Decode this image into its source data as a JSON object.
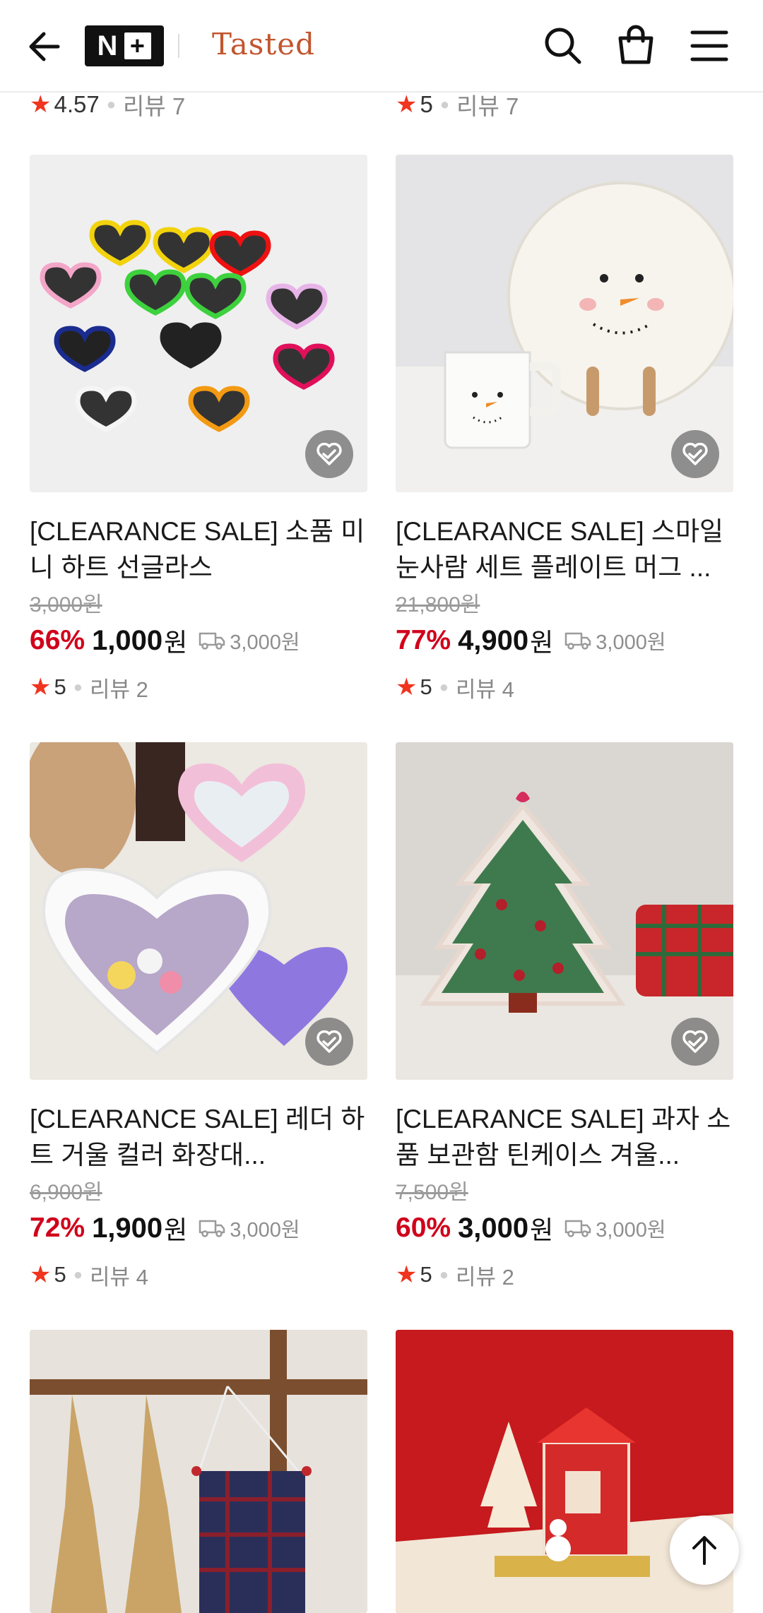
{
  "header": {
    "logo_text": "N",
    "logo_plus": "+",
    "brand": "Tasted"
  },
  "partial_top": [
    {
      "score": "4.57",
      "reviews": "리뷰 7"
    },
    {
      "score": "5",
      "reviews": "리뷰 7"
    }
  ],
  "products": [
    {
      "title": "[CLEARANCE SALE] 소품 미니 하트 선글라스",
      "original_price": "3,000원",
      "discount": "66%",
      "price": "1,000",
      "currency": "원",
      "shipping": "3,000원",
      "score": "5",
      "reviews": "리뷰 2"
    },
    {
      "title": "[CLEARANCE SALE] 스마일 눈사람 세트 플레이트 머그 ...",
      "original_price": "21,800원",
      "discount": "77%",
      "price": "4,900",
      "currency": "원",
      "shipping": "3,000원",
      "score": "5",
      "reviews": "리뷰 4"
    },
    {
      "title": "[CLEARANCE SALE] 레더 하트 거울 컬러 화장대...",
      "original_price": "6,900원",
      "discount": "72%",
      "price": "1,900",
      "currency": "원",
      "shipping": "3,000원",
      "score": "5",
      "reviews": "리뷰 4"
    },
    {
      "title": "[CLEARANCE SALE] 과자 소품 보관함 틴케이스 겨울...",
      "original_price": "7,500원",
      "discount": "60%",
      "price": "3,000",
      "currency": "원",
      "shipping": "3,000원",
      "score": "5",
      "reviews": "리뷰 2"
    }
  ],
  "colors": {
    "discount": "#d0021b",
    "star": "#f0341e",
    "brand": "#c2552e"
  },
  "icons": [
    "back-arrow-icon",
    "search-icon",
    "shopping-bag-icon",
    "hamburger-menu-icon",
    "wishlist-heart-icon",
    "delivery-truck-icon",
    "star-icon",
    "arrow-up-icon"
  ]
}
